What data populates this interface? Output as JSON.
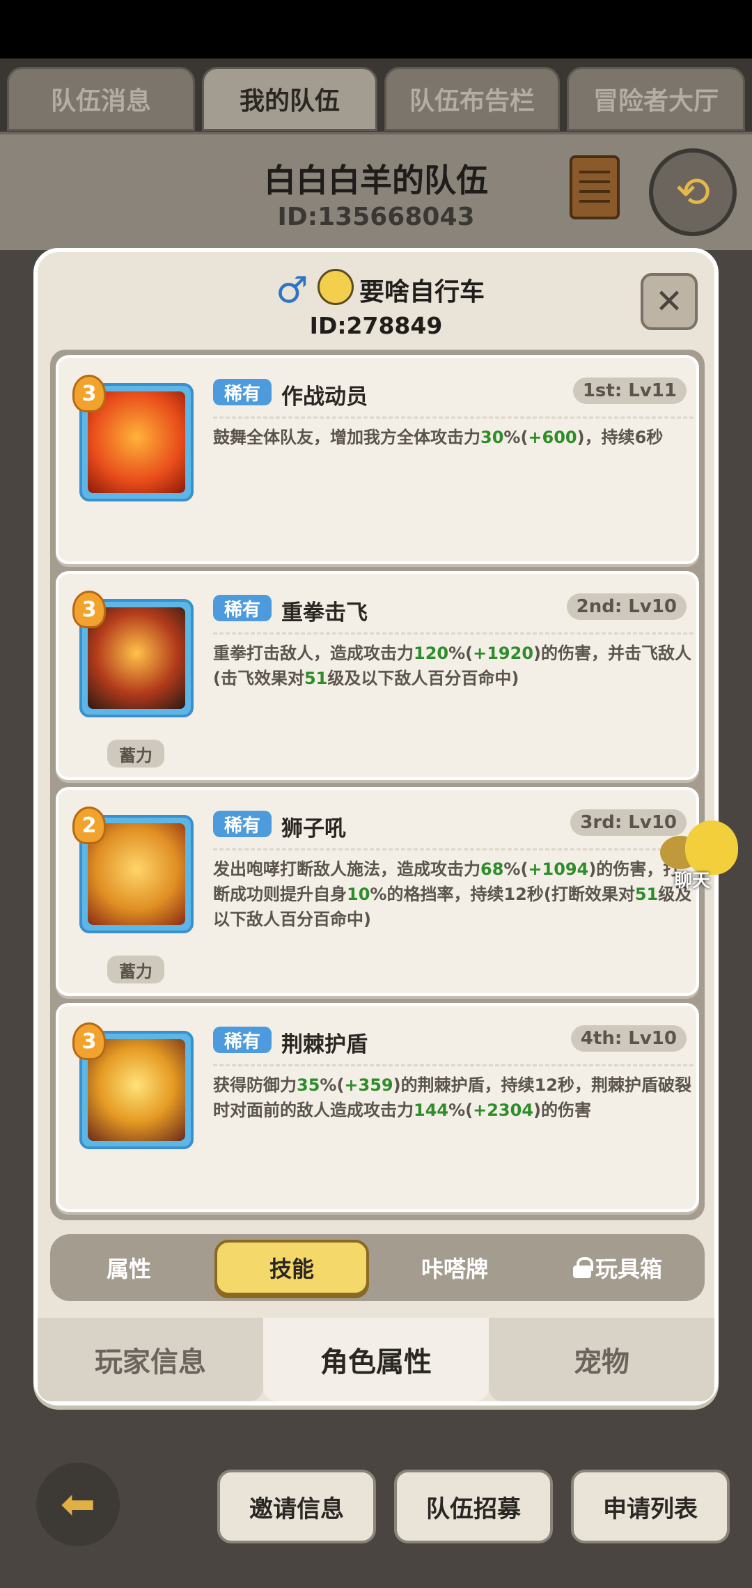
{
  "top_tabs": [
    "队伍消息",
    "我的队伍",
    "队伍布告栏",
    "冒险者大厅"
  ],
  "active_top_tab": 1,
  "team": {
    "name": "白白白羊的队伍",
    "id": "ID:135668043"
  },
  "player": {
    "name": "要啥自行车",
    "id": "ID:278849",
    "gender_icon": "♂"
  },
  "skills": [
    {
      "badge": "3",
      "rarity": "稀有",
      "name": "作战动员",
      "level": "1st: Lv11",
      "charge": null,
      "desc_parts": [
        {
          "t": "鼓舞全体队友，增加我方全体攻击力"
        },
        {
          "t": "30",
          "g": true
        },
        {
          "t": "%("
        },
        {
          "t": "+600",
          "g": true
        },
        {
          "t": ")，持续6秒"
        }
      ]
    },
    {
      "badge": "3",
      "rarity": "稀有",
      "name": "重拳击飞",
      "level": "2nd: Lv10",
      "charge": "蓄力",
      "desc_parts": [
        {
          "t": "重拳打击敌人，造成攻击力"
        },
        {
          "t": "120",
          "g": true
        },
        {
          "t": "%("
        },
        {
          "t": "+1920",
          "g": true
        },
        {
          "t": ")的伤害，并击飞敌人(击飞效果对"
        },
        {
          "t": "51",
          "g": true
        },
        {
          "t": "级及以下敌人百分百命中)"
        }
      ]
    },
    {
      "badge": "2",
      "rarity": "稀有",
      "name": "狮子吼",
      "level": "3rd: Lv10",
      "charge": "蓄力",
      "desc_parts": [
        {
          "t": "发出咆哮打断敌人施法，造成攻击力"
        },
        {
          "t": "68",
          "g": true
        },
        {
          "t": "%("
        },
        {
          "t": "+1094",
          "g": true
        },
        {
          "t": ")的伤害，打断成功则提升自身"
        },
        {
          "t": "10",
          "g": true
        },
        {
          "t": "%的格挡率，持续12秒(打断效果对"
        },
        {
          "t": "51",
          "g": true
        },
        {
          "t": "级及以下敌人百分百命中)"
        }
      ]
    },
    {
      "badge": "3",
      "rarity": "稀有",
      "name": "荆棘护盾",
      "level": "4th: Lv10",
      "charge": null,
      "desc_parts": [
        {
          "t": "获得防御力"
        },
        {
          "t": "35",
          "g": true
        },
        {
          "t": "%("
        },
        {
          "t": "+359",
          "g": true
        },
        {
          "t": ")的荆棘护盾，持续12秒，荆棘护盾破裂时对面前的敌人造成攻击力"
        },
        {
          "t": "144",
          "g": true
        },
        {
          "t": "%("
        },
        {
          "t": "+2304",
          "g": true
        },
        {
          "t": ")的伤害"
        }
      ]
    }
  ],
  "sub_tabs": [
    "属性",
    "技能",
    "咔嗒牌",
    "玩具箱"
  ],
  "active_sub_tab": 1,
  "bottom_tabs": [
    "玩家信息",
    "角色属性",
    "宠物"
  ],
  "active_bottom_tab": 1,
  "chat_label": "聊天",
  "bottom_buttons": [
    "邀请信息",
    "队伍招募",
    "申请列表"
  ],
  "close_glyph": "✕",
  "colors": {
    "accent_green": "#2e8d2a",
    "rarity_blue": "#4d9bdc",
    "active_yellow": "#f4d86a"
  }
}
